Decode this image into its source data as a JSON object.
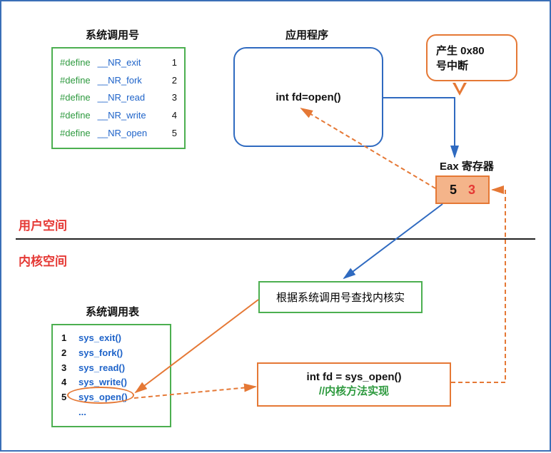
{
  "headings": {
    "syscall_number": "系统调用号",
    "application": "应用程序",
    "register": "Eax 寄存器",
    "syscall_table": "系统调用表"
  },
  "space": {
    "user": "用户空间",
    "kernel": "内核空间"
  },
  "defines": [
    {
      "kw": "#define",
      "name": "__NR_exit",
      "value": "1"
    },
    {
      "kw": "#define",
      "name": "__NR_fork",
      "value": "2"
    },
    {
      "kw": "#define",
      "name": "__NR_read",
      "value": "3"
    },
    {
      "kw": "#define",
      "name": "__NR_write",
      "value": "4"
    },
    {
      "kw": "#define",
      "name": "__NR_open",
      "value": "5"
    }
  ],
  "app_code": "int fd=open()",
  "callout": {
    "line1": "产生 0x80",
    "line2": "号中断"
  },
  "register": {
    "v1": "5",
    "v2": "3"
  },
  "lookup_text": "根据系统调用号查找内核实",
  "syscall_table": [
    {
      "idx": "1",
      "fn": "sys_exit()"
    },
    {
      "idx": "2",
      "fn": "sys_fork()"
    },
    {
      "idx": "3",
      "fn": "sys_read()"
    },
    {
      "idx": "4",
      "fn": "sys_write()"
    },
    {
      "idx": "5",
      "fn": "sys_open()"
    }
  ],
  "syscall_table_more": "...",
  "kernel_impl": {
    "code": "int fd = sys_open()",
    "comment": "//内核方法实现"
  }
}
